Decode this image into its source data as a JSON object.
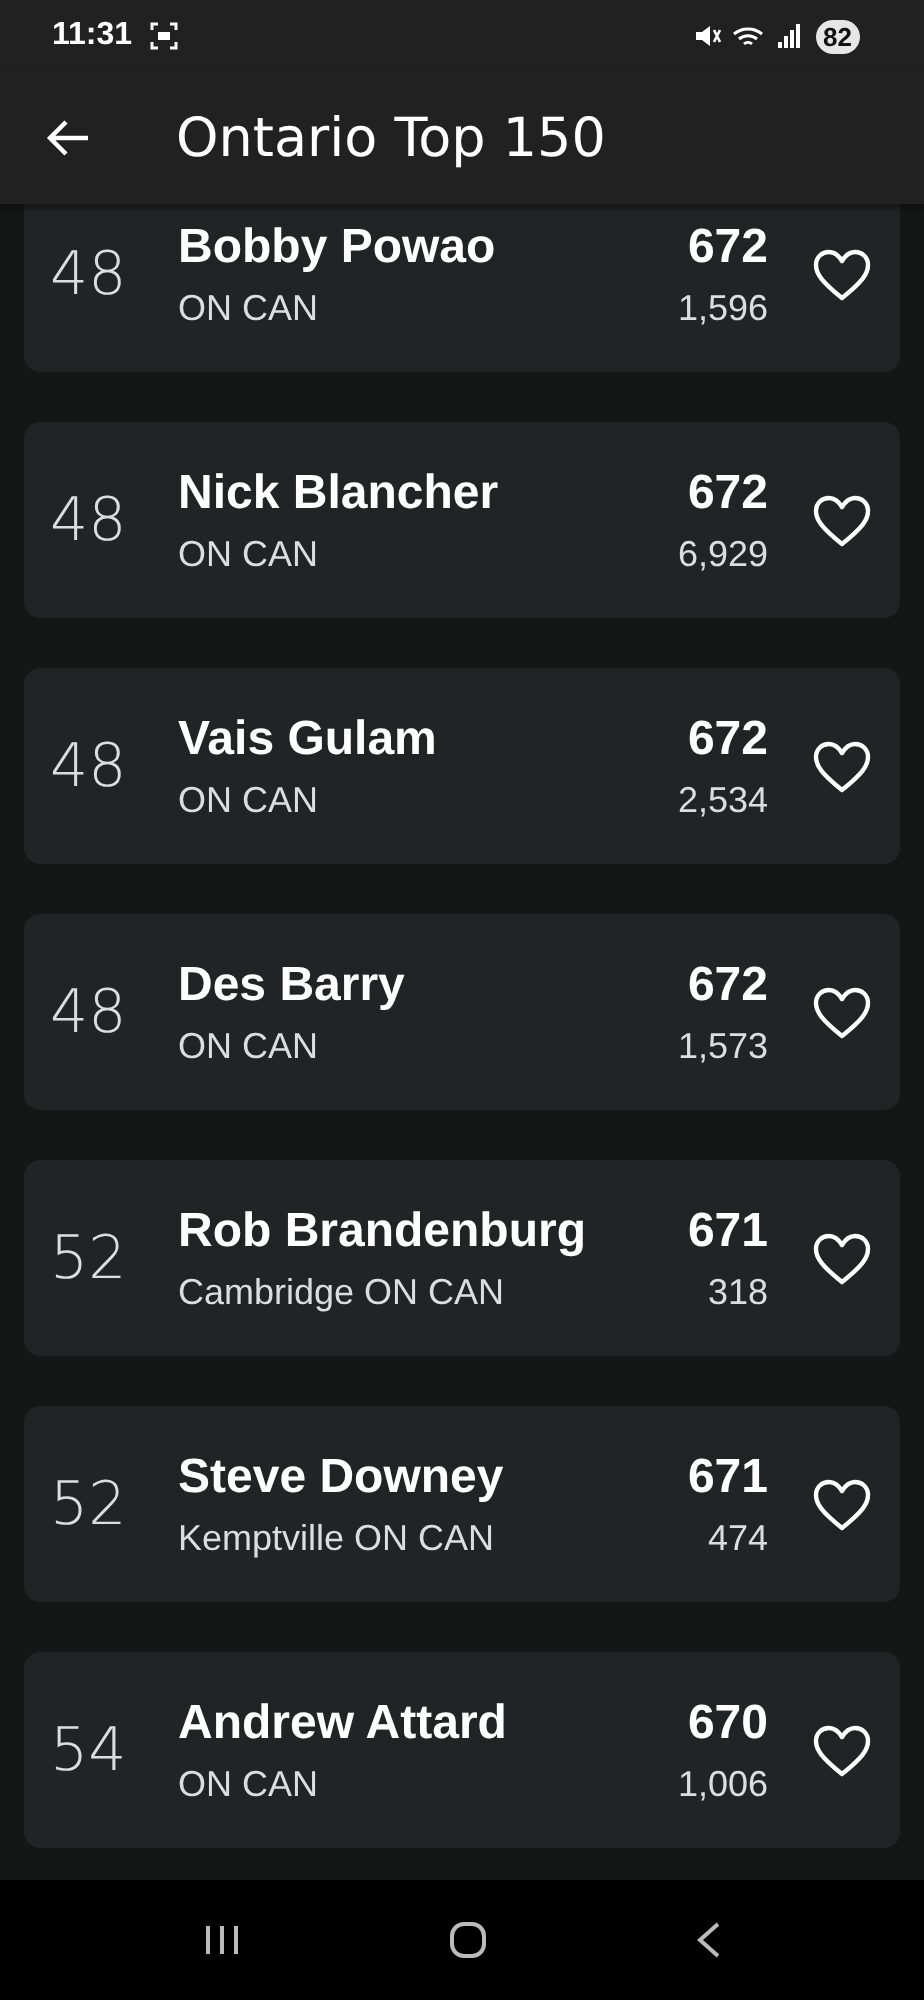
{
  "status_bar": {
    "time": "11:31",
    "battery": "82"
  },
  "header": {
    "title": "Ontario Top 150"
  },
  "players": [
    {
      "rank": "48",
      "name": "Bobby Powao",
      "location": "ON CAN",
      "score": "672",
      "count": "1,596",
      "favorited": false
    },
    {
      "rank": "48",
      "name": "Nick Blancher",
      "location": "ON CAN",
      "score": "672",
      "count": "6,929",
      "favorited": false
    },
    {
      "rank": "48",
      "name": "Vais Gulam",
      "location": "ON CAN",
      "score": "672",
      "count": "2,534",
      "favorited": false
    },
    {
      "rank": "48",
      "name": "Des Barry",
      "location": "ON CAN",
      "score": "672",
      "count": "1,573",
      "favorited": false
    },
    {
      "rank": "52",
      "name": "Rob Brandenburg",
      "location": "Cambridge ON CAN",
      "score": "671",
      "count": "318",
      "favorited": false
    },
    {
      "rank": "52",
      "name": "Steve Downey",
      "location": "Kemptville ON CAN",
      "score": "671",
      "count": "474",
      "favorited": false
    },
    {
      "rank": "54",
      "name": "Andrew Attard",
      "location": "ON CAN",
      "score": "670",
      "count": "1,006",
      "favorited": false
    }
  ]
}
